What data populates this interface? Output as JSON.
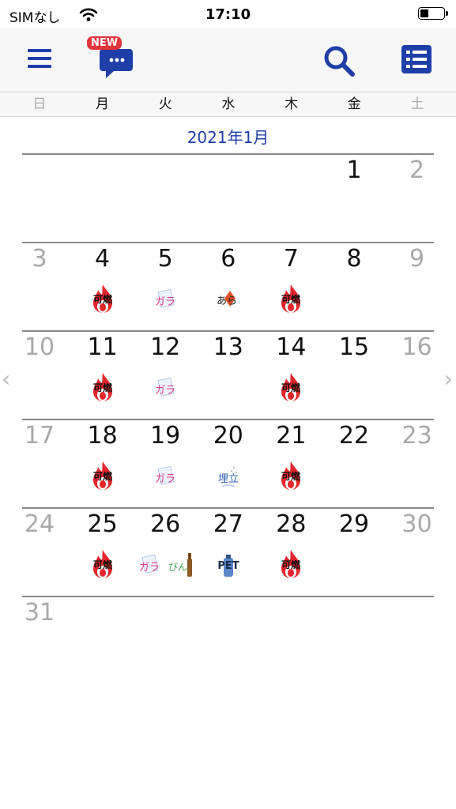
{
  "status_bar": {
    "carrier": "SIMなし",
    "time": "17:10"
  },
  "toolbar": {
    "new_badge": "NEW"
  },
  "weekdays": [
    "日",
    "月",
    "火",
    "水",
    "木",
    "金",
    "土"
  ],
  "month_title": "2021年1月",
  "calendar": {
    "days": [
      {
        "day": "1",
        "col": 5,
        "row": 0,
        "icons": []
      },
      {
        "day": "2",
        "col": 6,
        "row": 0,
        "icons": []
      },
      {
        "day": "3",
        "col": 0,
        "row": 1,
        "icons": []
      },
      {
        "day": "4",
        "col": 1,
        "row": 1,
        "icons": [
          "burnable"
        ]
      },
      {
        "day": "5",
        "col": 2,
        "row": 1,
        "icons": [
          "paper"
        ]
      },
      {
        "day": "6",
        "col": 3,
        "row": 1,
        "icons": [
          "ashes"
        ]
      },
      {
        "day": "7",
        "col": 4,
        "row": 1,
        "icons": [
          "burnable"
        ]
      },
      {
        "day": "8",
        "col": 5,
        "row": 1,
        "icons": []
      },
      {
        "day": "9",
        "col": 6,
        "row": 1,
        "icons": []
      },
      {
        "day": "10",
        "col": 0,
        "row": 2,
        "icons": []
      },
      {
        "day": "11",
        "col": 1,
        "row": 2,
        "icons": [
          "burnable"
        ]
      },
      {
        "day": "12",
        "col": 2,
        "row": 2,
        "icons": [
          "paper"
        ]
      },
      {
        "day": "13",
        "col": 3,
        "row": 2,
        "icons": []
      },
      {
        "day": "14",
        "col": 4,
        "row": 2,
        "icons": [
          "burnable"
        ]
      },
      {
        "day": "15",
        "col": 5,
        "row": 2,
        "icons": []
      },
      {
        "day": "16",
        "col": 6,
        "row": 2,
        "icons": []
      },
      {
        "day": "17",
        "col": 0,
        "row": 3,
        "icons": []
      },
      {
        "day": "18",
        "col": 1,
        "row": 3,
        "icons": [
          "burnable"
        ]
      },
      {
        "day": "19",
        "col": 2,
        "row": 3,
        "icons": [
          "paper"
        ]
      },
      {
        "day": "20",
        "col": 3,
        "row": 3,
        "icons": [
          "landfill"
        ]
      },
      {
        "day": "21",
        "col": 4,
        "row": 3,
        "icons": [
          "burnable"
        ]
      },
      {
        "day": "22",
        "col": 5,
        "row": 3,
        "icons": []
      },
      {
        "day": "23",
        "col": 6,
        "row": 3,
        "icons": []
      },
      {
        "day": "24",
        "col": 0,
        "row": 4,
        "icons": []
      },
      {
        "day": "25",
        "col": 1,
        "row": 4,
        "icons": [
          "burnable"
        ]
      },
      {
        "day": "26",
        "col": 2,
        "row": 4,
        "icons": [
          "paper",
          "bottle"
        ]
      },
      {
        "day": "27",
        "col": 3,
        "row": 4,
        "icons": [
          "pet"
        ]
      },
      {
        "day": "28",
        "col": 4,
        "row": 4,
        "icons": [
          "burnable"
        ]
      },
      {
        "day": "29",
        "col": 5,
        "row": 4,
        "icons": []
      },
      {
        "day": "30",
        "col": 6,
        "row": 4,
        "icons": []
      },
      {
        "day": "31",
        "col": 0,
        "row": 5,
        "icons": []
      }
    ]
  },
  "icon_labels": {
    "burnable": "可燃",
    "paper": "ガラ",
    "ashes": "あら",
    "landfill": "埋立",
    "bottle": "びん",
    "pet": "PET"
  },
  "colors": {
    "accent_blue": "#1f3ea8",
    "month_title": "#1f3ea8",
    "burn_red": "#e3262b",
    "paper_pink": "#e0338c",
    "landfill_blue": "#2c5fb0",
    "bottle_green": "#3aa04a",
    "weekend_gray": "#a9a9a9"
  }
}
